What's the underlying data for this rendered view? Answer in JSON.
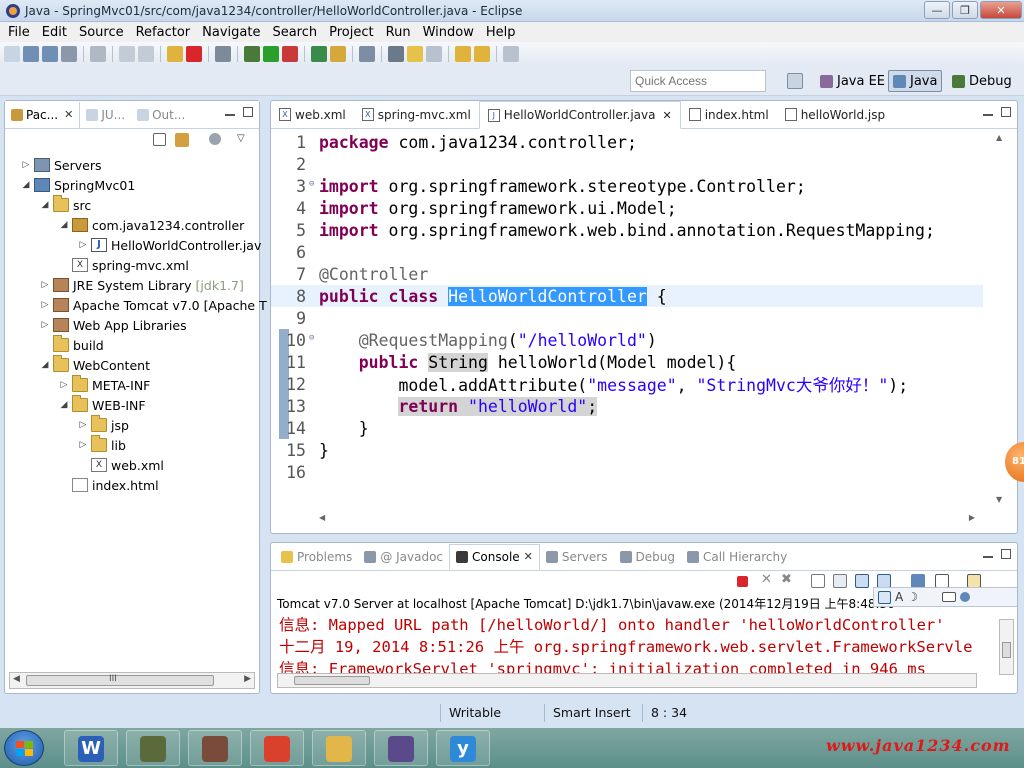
{
  "window": {
    "title": "Java - SpringMvc01/src/com/java1234/controller/HelloWorldController.java - Eclipse",
    "minimize": "—",
    "maximize": "❐",
    "close": "✕"
  },
  "menu": [
    "File",
    "Edit",
    "Source",
    "Refactor",
    "Navigate",
    "Search",
    "Project",
    "Run",
    "Window",
    "Help"
  ],
  "quick_access": {
    "placeholder": "Quick Access"
  },
  "perspectives": [
    {
      "label": "Java EE",
      "active": false
    },
    {
      "label": "Java",
      "active": true
    },
    {
      "label": "Debug",
      "active": false
    }
  ],
  "package_explorer": {
    "tabs": [
      {
        "label": "Pac...",
        "active": true
      },
      {
        "label": "JU...",
        "active": false
      },
      {
        "label": "Out...",
        "active": false
      }
    ],
    "tree": [
      {
        "label": "Servers",
        "twisty": "▷",
        "icon": "server",
        "level": 0
      },
      {
        "label": "SpringMvc01",
        "twisty": "◢",
        "icon": "proj",
        "level": 0
      },
      {
        "label": "src",
        "twisty": "◢",
        "icon": "folder",
        "level": 1
      },
      {
        "label": "com.java1234.controller",
        "twisty": "◢",
        "icon": "pkg",
        "level": 2
      },
      {
        "label": "HelloWorldController.jav",
        "twisty": "▷",
        "icon": "java",
        "level": 3
      },
      {
        "label": "spring-mvc.xml",
        "twisty": "",
        "icon": "xml",
        "level": 2
      },
      {
        "label": "JRE System Library",
        "suffix": "[jdk1.7]",
        "twisty": "▷",
        "icon": "lib",
        "level": 1
      },
      {
        "label": "Apache Tomcat v7.0 [Apache T",
        "twisty": "▷",
        "icon": "lib",
        "level": 1
      },
      {
        "label": "Web App Libraries",
        "twisty": "▷",
        "icon": "lib",
        "level": 1
      },
      {
        "label": "build",
        "twisty": "",
        "icon": "folder",
        "level": 1
      },
      {
        "label": "WebContent",
        "twisty": "◢",
        "icon": "folder",
        "level": 1
      },
      {
        "label": "META-INF",
        "twisty": "▷",
        "icon": "folder",
        "level": 2
      },
      {
        "label": "WEB-INF",
        "twisty": "◢",
        "icon": "folder",
        "level": 2
      },
      {
        "label": "jsp",
        "twisty": "▷",
        "icon": "folder",
        "level": 3
      },
      {
        "label": "lib",
        "twisty": "▷",
        "icon": "folder",
        "level": 3
      },
      {
        "label": "web.xml",
        "twisty": "",
        "icon": "xml",
        "level": 3
      },
      {
        "label": "index.html",
        "twisty": "",
        "icon": "html",
        "level": 2
      }
    ],
    "scroll_label": "III"
  },
  "editor": {
    "tabs": [
      {
        "label": "web.xml",
        "icon": "X",
        "active": false
      },
      {
        "label": "spring-mvc.xml",
        "icon": "X",
        "active": false
      },
      {
        "label": "HelloWorldController.java",
        "icon": "J",
        "active": true
      },
      {
        "label": "index.html",
        "icon": "",
        "active": false
      },
      {
        "label": "helloWorld.jsp",
        "icon": "",
        "active": false
      }
    ],
    "lines": [
      {
        "n": "1",
        "parts": [
          [
            "kw",
            "package"
          ],
          [
            "",
            " com.java1234.controller;"
          ]
        ]
      },
      {
        "n": "2",
        "parts": []
      },
      {
        "n": "3",
        "fold": true,
        "parts": [
          [
            "kw",
            "import"
          ],
          [
            "",
            " org.springframework.stereotype.Controller;"
          ]
        ]
      },
      {
        "n": "4",
        "parts": [
          [
            "kw",
            "import"
          ],
          [
            "",
            " org.springframework.ui.Model;"
          ]
        ]
      },
      {
        "n": "5",
        "parts": [
          [
            "kw",
            "import"
          ],
          [
            "",
            " org.springframework.web.bind.annotation.RequestMapping;"
          ]
        ]
      },
      {
        "n": "6",
        "parts": []
      },
      {
        "n": "7",
        "parts": [
          [
            "ann",
            "@Controller"
          ]
        ]
      },
      {
        "n": "8",
        "highlight": true,
        "parts": [
          [
            "kw",
            "public"
          ],
          [
            "",
            " "
          ],
          [
            "kw",
            "class"
          ],
          [
            "",
            " "
          ],
          [
            "sel",
            "HelloWorldController"
          ],
          [
            "",
            " {"
          ]
        ]
      },
      {
        "n": "9",
        "parts": []
      },
      {
        "n": "10",
        "fold": true,
        "parts": [
          [
            "",
            "    "
          ],
          [
            "ann",
            "@RequestMapping"
          ],
          [
            "",
            "("
          ],
          [
            "str",
            "\"/helloWorld\""
          ],
          [
            "",
            ")"
          ]
        ]
      },
      {
        "n": "11",
        "parts": [
          [
            "",
            "    "
          ],
          [
            "kw",
            "public"
          ],
          [
            "",
            " "
          ],
          [
            "occ",
            "String"
          ],
          [
            "",
            " helloWorld(Model model){"
          ]
        ]
      },
      {
        "n": "12",
        "parts": [
          [
            "",
            "        model.addAttribute("
          ],
          [
            "str",
            "\"message\""
          ],
          [
            "",
            ", "
          ],
          [
            "str",
            "\"StringMvc大爷你好！\""
          ],
          [
            "",
            ");"
          ]
        ]
      },
      {
        "n": "13",
        "parts": [
          [
            "",
            "        "
          ],
          [
            "kw occ",
            "return"
          ],
          [
            "occ",
            " "
          ],
          [
            "str occ",
            "\"helloWorld\""
          ],
          [
            "occ",
            ";"
          ]
        ]
      },
      {
        "n": "14",
        "parts": [
          [
            "",
            "    }"
          ]
        ]
      },
      {
        "n": "15",
        "parts": [
          [
            "",
            "}"
          ]
        ]
      },
      {
        "n": "16",
        "parts": []
      }
    ]
  },
  "console": {
    "tabs": [
      {
        "label": "Problems",
        "active": false
      },
      {
        "label": "@ Javadoc",
        "active": false
      },
      {
        "label": "Console",
        "active": true
      },
      {
        "label": "Servers",
        "active": false
      },
      {
        "label": "Debug",
        "active": false
      },
      {
        "label": "Call Hierarchy",
        "active": false
      }
    ],
    "header": "Tomcat v7.0 Server at localhost [Apache Tomcat] D:\\jdk1.7\\bin\\javaw.exe (2014年12月19日 上午8:48:36",
    "lines": [
      "信息: Mapped URL path [/helloWorld/] onto handler 'helloWorldController'",
      "十二月 19, 2014 8:51:26 上午 org.springframework.web.servlet.FrameworkServle",
      "信息: FrameworkServlet 'springmvc': initialization completed in 946 ms"
    ],
    "find_glyphs": [
      "A",
      "☽"
    ]
  },
  "status": {
    "writable": "Writable",
    "insert_mode": "Smart Insert",
    "position": "8 : 34"
  },
  "badge": "81",
  "taskbar": {
    "apps": [
      {
        "name": "wps-writer",
        "glyph": "W",
        "color": "#2b5fb8"
      },
      {
        "name": "app-2",
        "glyph": "",
        "color": "#5a6a3a"
      },
      {
        "name": "app-3",
        "glyph": "",
        "color": "#7a4a3a"
      },
      {
        "name": "chrome",
        "glyph": "",
        "color": "#d9412c"
      },
      {
        "name": "explorer",
        "glyph": "",
        "color": "#e3b64a"
      },
      {
        "name": "eclipse-javaee",
        "glyph": "",
        "color": "#5a4a8a"
      },
      {
        "name": "app-7",
        "glyph": "y",
        "color": "#2e8ad8"
      }
    ],
    "watermark": "www.java1234.com"
  },
  "colors": {
    "keyword": "#7f0055",
    "string": "#2a00ff",
    "annotation": "#646464",
    "selection": "#3399ff",
    "console_error": "#c00000"
  }
}
